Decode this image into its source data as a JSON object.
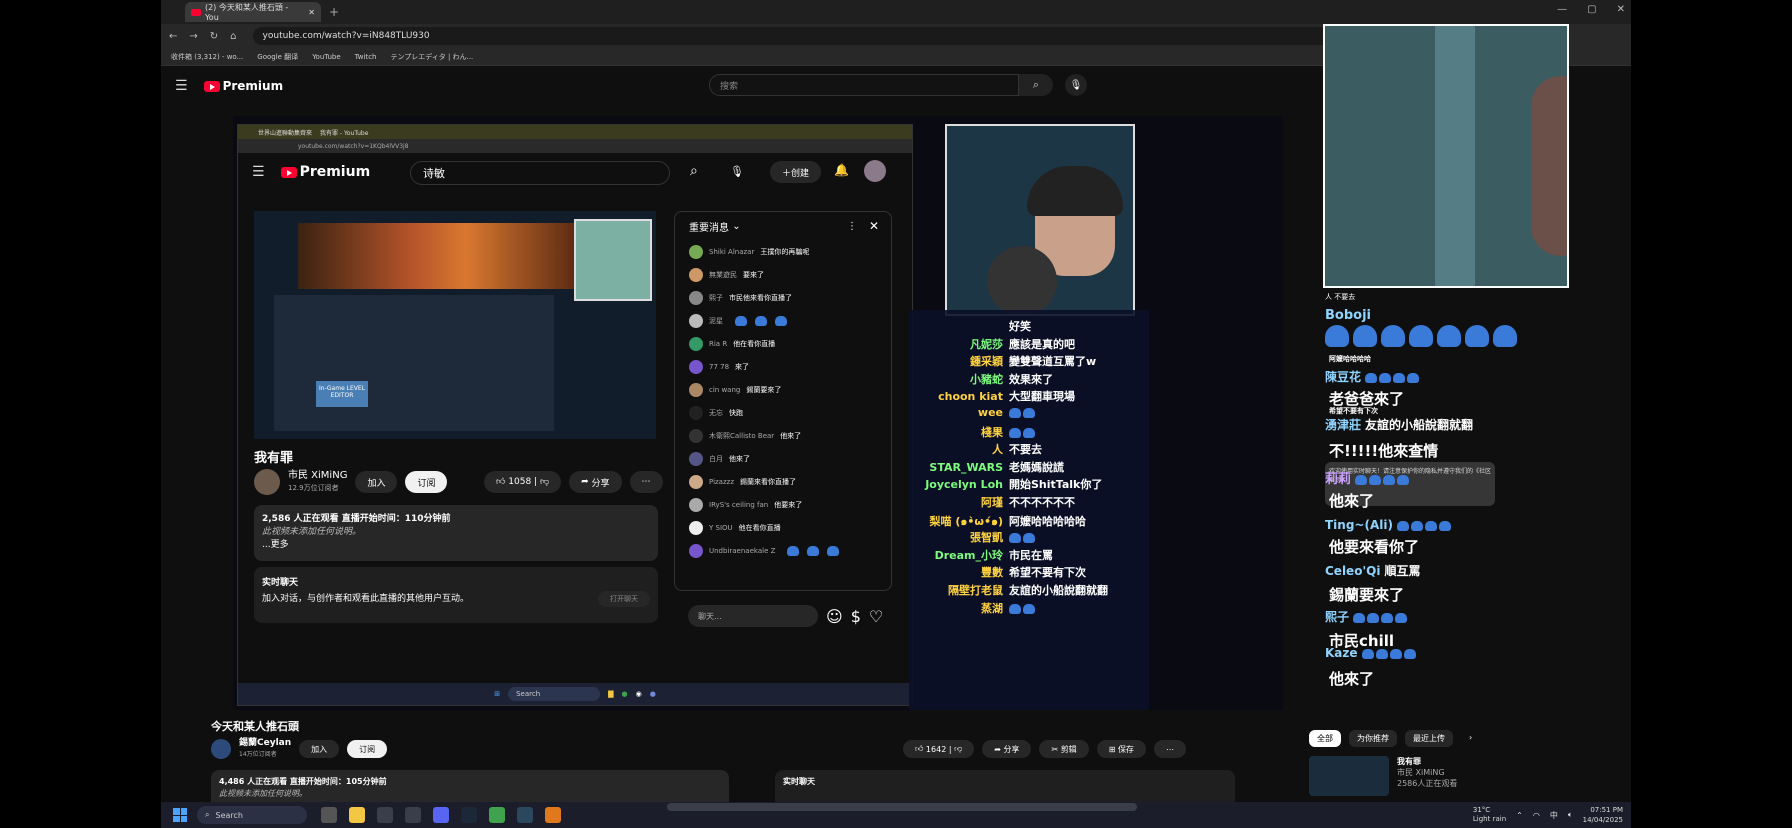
{
  "browser": {
    "tab_title": "(2) 今天和某人推石頭 - You",
    "url": "youtube.com/watch?v=iN848TLU930",
    "bookmarks": [
      "收件箱 (3,312) - wo...",
      "Google 翻译",
      "YouTube",
      "Twitch",
      "テンプレエディタ | わん..."
    ]
  },
  "header": {
    "logo_text": "Premium",
    "search_placeholder": "搜索",
    "search_icon": "search-icon",
    "mic_icon": "mic-icon"
  },
  "inner": {
    "tabs": [
      "世界山進聯動集齊來",
      "我有罪 - YouTube"
    ],
    "url": "youtube.com/watch?v=1KQb4lVV3j8",
    "logo_text": "Premium",
    "search_value": "诗敏",
    "create_label": "创建",
    "level_editor_label": "In-Game LEVEL EDITOR",
    "title": "我有罪",
    "channel_name": "市民 XiMiNG",
    "subscribers": "12.9万位订阅者",
    "join_label": "加入",
    "subscribe_label": "订阅",
    "like_count": "1058",
    "share_label": "分享",
    "desc_line1": "2,586 人正在观看  直播开始时间：110分钟前",
    "desc_line2": "此视频未添加任何说明。",
    "desc_more": "...更多",
    "livechat_title": "实时聊天",
    "livechat_text": "加入对话，与创作者和观看此直播的其他用户互动。",
    "livechat_button": "打开聊天",
    "chat_header": "重要消息",
    "chat_placeholder": "聊天...",
    "taskbar_search": "Search",
    "chat_messages": [
      {
        "name": "Shiki Alnazar",
        "text": "王撲你的再騙呢",
        "color": "#7a5"
      },
      {
        "name": "無業遊民",
        "text": "要來了",
        "color": "#c96"
      },
      {
        "name": "熙子",
        "text": "市民他來看你直播了",
        "color": "#888"
      },
      {
        "name": "泥星",
        "text": "",
        "color": "#bbb"
      },
      {
        "name": "Ria R",
        "text": "他在看你直播",
        "color": "#396"
      },
      {
        "name": "77 78",
        "text": "來了",
        "color": "#75c"
      },
      {
        "name": "cin wang",
        "text": "錫蘭要來了",
        "color": "#a86"
      },
      {
        "name": "无忘",
        "text": "快跑",
        "color": "#222"
      },
      {
        "name": "木衛熙Callisto Bear",
        "text": "他來了",
        "color": "#333"
      },
      {
        "name": "白月",
        "text": "他來了",
        "color": "#558"
      },
      {
        "name": "Pizazzz",
        "text": "錫蘭來看你直播了",
        "color": "#ca8"
      },
      {
        "name": "IRyS's ceiling fan",
        "text": "他要來了",
        "color": "#aaa"
      },
      {
        "name": "Y SIOU",
        "text": "他在看你直播",
        "color": "#eee"
      },
      {
        "name": "Undbiraenaekale Z",
        "text": "",
        "color": "#75c"
      }
    ]
  },
  "overlay_chat": [
    {
      "name": "",
      "text": "好笑",
      "color": "#ffd23f"
    },
    {
      "name": "凡妮莎",
      "text": "應該是真的吧",
      "color": "#7cfc7c"
    },
    {
      "name": "鍾采穎",
      "text": "變雙聲道互罵了w",
      "color": "#ffd23f"
    },
    {
      "name": "小豬蛇",
      "text": "效果來了",
      "color": "#7cfc7c"
    },
    {
      "name": "choon kiat",
      "text": "大型翻車現場",
      "color": "#ffd23f"
    },
    {
      "name": "wee",
      "text": "",
      "color": "#ffd23f"
    },
    {
      "name": "棧果",
      "text": "",
      "color": "#ffd23f"
    },
    {
      "name": "人",
      "text": "不要去",
      "color": "#ffd23f"
    },
    {
      "name": "STAR_WARS",
      "text": "老媽媽說謊",
      "color": "#7cfc7c"
    },
    {
      "name": "Joycelyn Loh",
      "text": "開始ShitTalk你了",
      "color": "#7cfc7c"
    },
    {
      "name": "阿瑾",
      "text": "不不不不不不",
      "color": "#ffd23f"
    },
    {
      "name": "梨喵 (๑•̀ω•́๑)",
      "text": "阿嬤哈哈哈哈哈",
      "color": "#ffd23f"
    },
    {
      "name": "張智凱",
      "text": "",
      "color": "#ffd23f"
    },
    {
      "name": "Dream_小玲",
      "text": "市民在罵",
      "color": "#7cfc7c"
    },
    {
      "name": "豐數",
      "text": "希望不要有下次",
      "color": "#ffd23f"
    },
    {
      "name": "隔壁打老鼠",
      "text": "友誼的小船說翻就翻",
      "color": "#ffd23f"
    },
    {
      "name": "蒸湖",
      "text": "",
      "color": "#ffd23f"
    }
  ],
  "right_chat": {
    "top_line": "人  不要去",
    "lines": [
      {
        "name": "Boboji",
        "text": "",
        "size": 13,
        "color": "#8fd3ff"
      },
      {
        "name": "",
        "text": "阿嬤哈哈哈哈",
        "size": 7,
        "color": "#fff"
      },
      {
        "name": "陳豆花",
        "text": "",
        "size": 12,
        "color": "#8fd3ff"
      },
      {
        "name": "",
        "text": "老爸爸來了",
        "size": 15,
        "color": "#fff"
      },
      {
        "name": "",
        "text": "希望不要有下次",
        "size": 7,
        "color": "#fff"
      },
      {
        "name": "湧津莊",
        "text": "友誼的小船說翻就翻",
        "size": 12,
        "color": "#8fd3ff"
      },
      {
        "name": "",
        "text": "不!!!!!他來查情",
        "size": 15,
        "color": "#fff"
      },
      {
        "name": "莉莉",
        "text": "",
        "size": 13,
        "color": "#c9a0ff"
      },
      {
        "name": "",
        "text": "他來了",
        "size": 15,
        "color": "#fff"
      },
      {
        "name": "Ting~(Ali)",
        "text": "",
        "size": 12,
        "color": "#8fd3ff"
      },
      {
        "name": "",
        "text": "他要來看你了",
        "size": 15,
        "color": "#fff"
      },
      {
        "name": "Celeo'Qi",
        "text": "順互罵",
        "size": 12,
        "color": "#8fd3ff"
      },
      {
        "name": "",
        "text": "錫蘭要來了",
        "size": 15,
        "color": "#fff"
      },
      {
        "name": "熙子",
        "text": "",
        "size": 12,
        "color": "#8fd3ff"
      },
      {
        "name": "",
        "text": "市民chill",
        "size": 15,
        "color": "#fff"
      },
      {
        "name": "Kaze",
        "text": "",
        "size": 12,
        "color": "#8fd3ff"
      },
      {
        "name": "",
        "text": "他來了",
        "size": 15,
        "color": "#fff"
      }
    ],
    "notice": "欢迎使用实时聊天！请注意保护你的隐私并遵守我们的《社区准则》。"
  },
  "video_below": {
    "title": "今天和某人推石頭",
    "channel_name": "錫蘭Ceylan",
    "subscribers": "14万位订阅者",
    "join_label": "加入",
    "subscribe_label": "订阅",
    "like_count": "1642",
    "share_label": "分享",
    "clip_label": "剪辑",
    "save_label": "保存",
    "desc_line1": "4,486 人正在观看  直播开始时间：105分钟前",
    "desc_line2": "此视频未添加任何说明。",
    "livechat_title": "实时聊天",
    "rec_tabs": [
      "全部",
      "为你推荐",
      "最近上传"
    ],
    "rec_title": "我有罪",
    "rec_channel": "市民 XiMiNG",
    "rec_viewers": "2586人正在观看"
  },
  "taskbar": {
    "search_label": "Search",
    "weather_temp": "31°C",
    "weather_desc": "Light rain",
    "ime": "中",
    "time": "07:51 PM",
    "date": "14/04/2025"
  }
}
